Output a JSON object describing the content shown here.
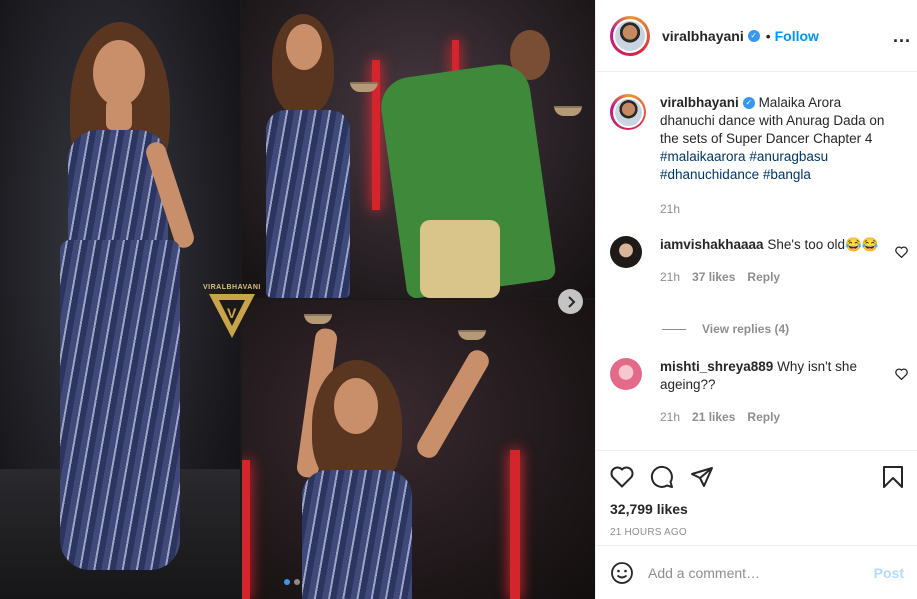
{
  "media": {
    "watermark": "VIRALBHAVANI",
    "next_icon": "chevron-right-icon",
    "carousel": {
      "slides": 2,
      "active": 1
    }
  },
  "header": {
    "username": "viralbhayani",
    "separator": "•",
    "follow_label": "Follow",
    "more_icon": "ellipsis-icon",
    "more_label": "..."
  },
  "caption": {
    "username": "viralbhayani",
    "text": "Malaika Arora dhanuchi dance with Anurag Dada on the sets of Super Dancer Chapter 4",
    "hashtags": [
      "#malaikaarora",
      "#anuragbasu",
      "#dhanuchidance",
      "#bangla"
    ],
    "time": "21h"
  },
  "comments": [
    {
      "username": "iamvishakhaaaa",
      "text": "She's too old😂😂",
      "time": "21h",
      "likes": "37 likes",
      "reply_label": "Reply",
      "avatar_color": "#2a2a2a"
    },
    {
      "username": "mishti_shreya889",
      "text": "Why isn't she ageing??",
      "time": "21h",
      "likes": "21 likes",
      "reply_label": "Reply",
      "avatar_color": "#e46a8a"
    }
  ],
  "view_replies": "View replies (4)",
  "actions": {
    "likes": "32,799 likes",
    "timestamp": "21 HOURS AGO"
  },
  "add_comment": {
    "placeholder": "Add a comment…",
    "post_label": "Post"
  },
  "colors": {
    "accent": "#0095f6",
    "verified": "#3897f0",
    "post_disabled": "#b3dbff"
  }
}
